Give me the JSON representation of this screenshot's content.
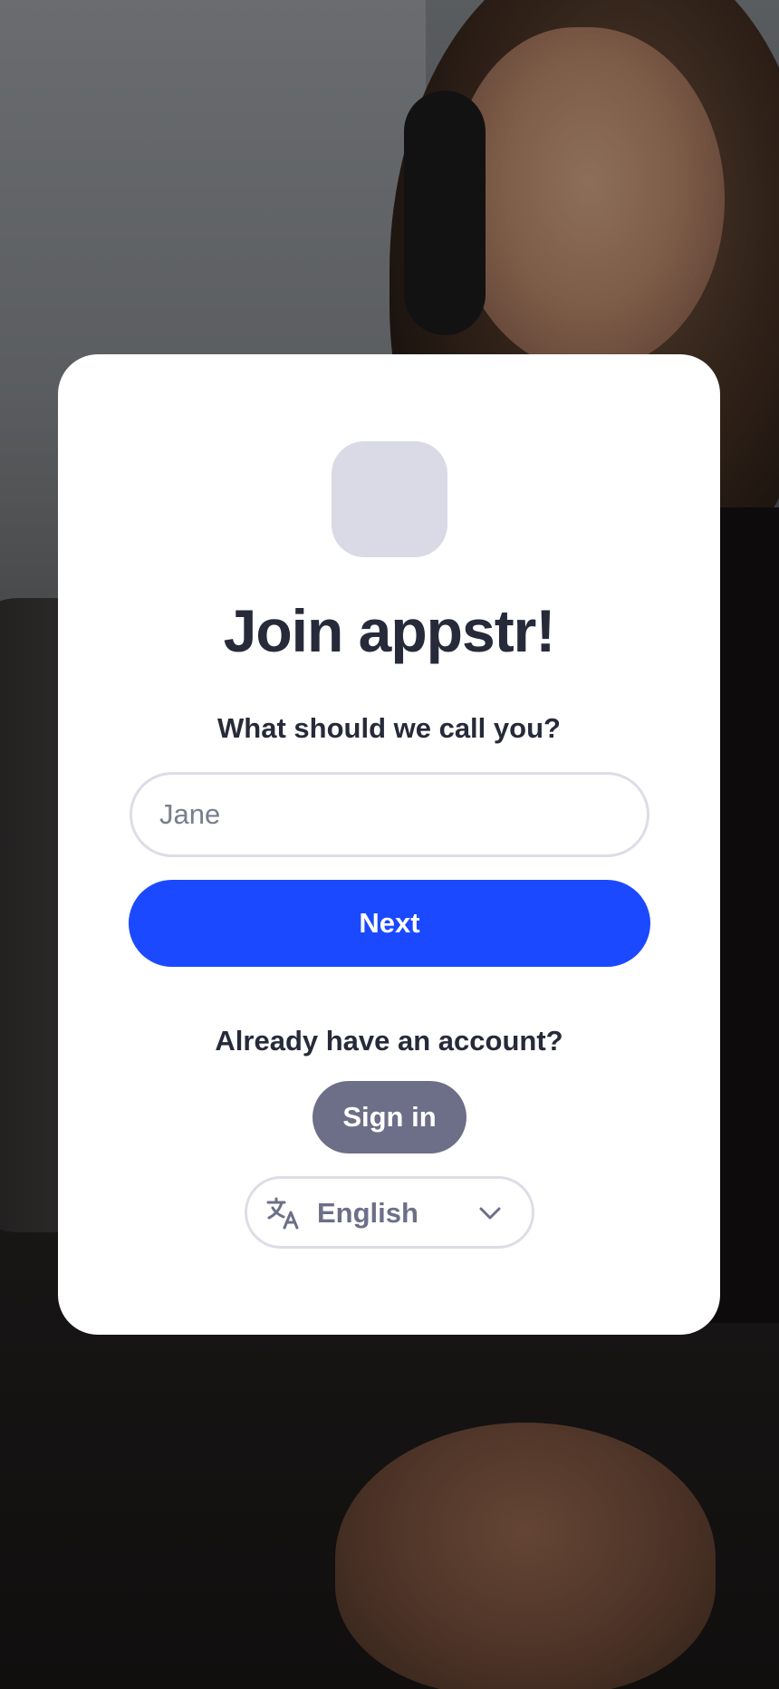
{
  "background": {
    "icon": "background-photo"
  },
  "card": {
    "logo_icon": "app-logo-placeholder",
    "title": "Join appstr!",
    "prompt": "What should we call you?",
    "name_input": {
      "value": "",
      "placeholder": "Jane"
    },
    "next_label": "Next",
    "already_text": "Already have an account?",
    "signin_label": "Sign in",
    "language": {
      "icon": "translate-icon",
      "selected": "English",
      "chevron_icon": "chevron-down-icon"
    }
  },
  "colors": {
    "primary": "#1b49ff",
    "secondary": "#6d6f88",
    "text": "#262a39",
    "logo_placeholder": "#d9dae6",
    "border": "#dcdde7"
  }
}
